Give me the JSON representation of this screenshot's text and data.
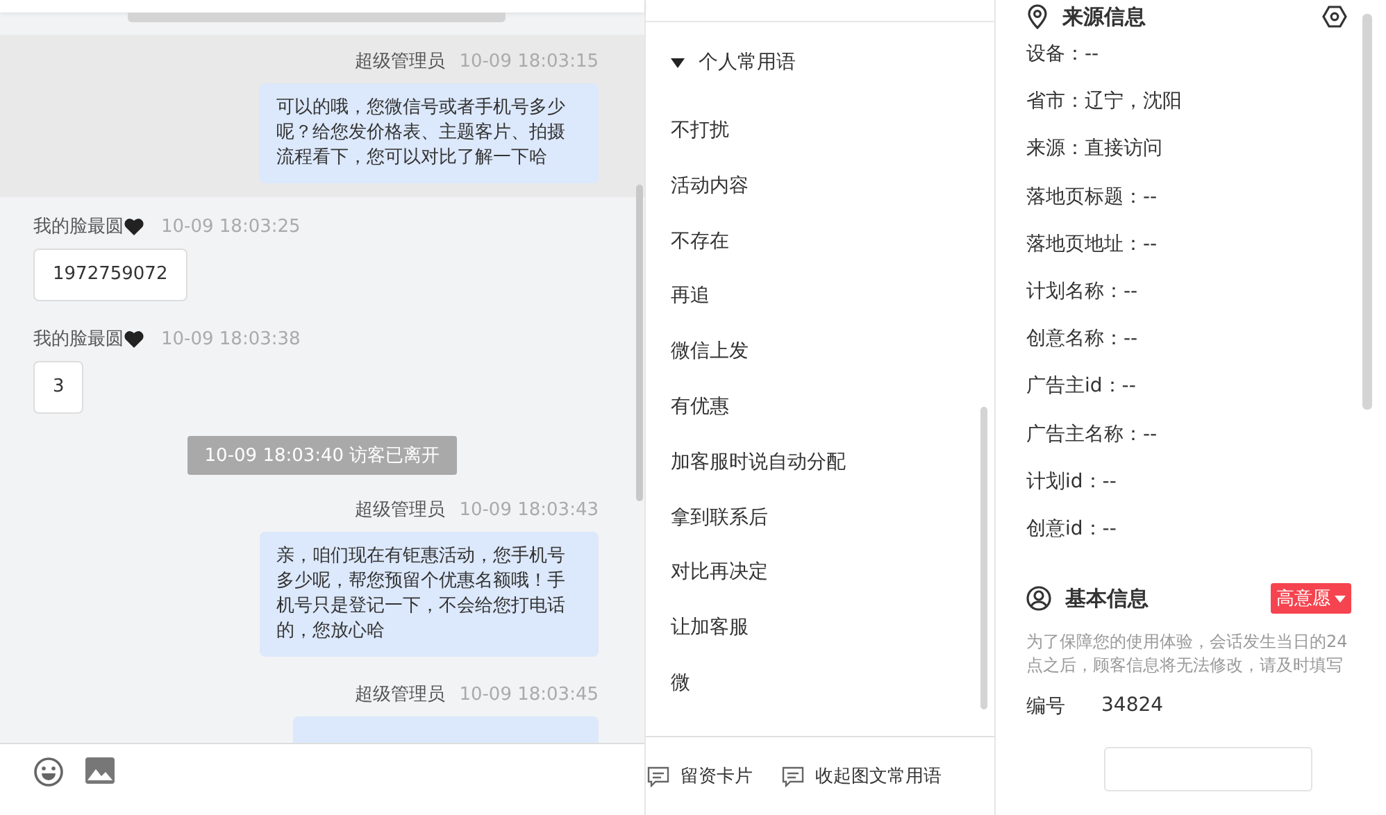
{
  "chat": {
    "messages": [
      {
        "kind": "agent",
        "sender": "超级管理员",
        "time": "10-09 18:03:15",
        "text": "可以的哦，您微信号或者手机号多少呢？给您发价格表、主题客片、拍摄流程看下，您可以对比了解一下哈",
        "highlighted": true
      },
      {
        "kind": "visitor",
        "sender": "我的脸最圆",
        "time": "10-09 18:03:25",
        "text": "1972759072",
        "highlighted": false
      },
      {
        "kind": "visitor",
        "sender": "我的脸最圆",
        "time": "10-09 18:03:38",
        "text": "3",
        "highlighted": false
      },
      {
        "kind": "system",
        "text": "10-09 18:03:40 访客已离开",
        "highlighted": false
      },
      {
        "kind": "agent",
        "sender": "超级管理员",
        "time": "10-09 18:03:43",
        "text": "亲，咱们现在有钜惠活动，您手机号多少呢，帮您预留个优惠名额哦！手机号只是登记一下，不会给您打电话的，您放心哈",
        "highlighted": false
      },
      {
        "kind": "agent",
        "sender": "超级管理员",
        "time": "10-09 18:03:45",
        "highlighted": false
      }
    ]
  },
  "phrases": {
    "group": "个人常用语",
    "expanded": true,
    "items": [
      "不打扰",
      "活动内容",
      "不存在",
      "再追",
      "微信上发",
      "有优惠",
      "加客服时说自动分配",
      "拿到联系后",
      "对比再决定",
      "让加客服",
      "微"
    ],
    "actions": [
      {
        "label": "留资卡片"
      },
      {
        "label": "收起图文常用语"
      }
    ]
  },
  "source_info": {
    "title": "来源信息",
    "fields": [
      "设备：--",
      "省市：辽宁，沈阳",
      "来源：直接访问",
      "落地页标题：--",
      "落地页地址：--",
      "计划名称：--",
      "创意名称：--",
      "广告主id：--",
      "广告主名称：--",
      "计划id：--",
      "创意id：--"
    ]
  },
  "basic_info": {
    "title": "基本信息",
    "intent": "高意愿",
    "note": "为了保障您的使用体验，会话发生当日的24点之后，顾客信息将无法修改，请及时填写",
    "fields": [
      {
        "label": "编号",
        "value": "34824"
      }
    ]
  }
}
